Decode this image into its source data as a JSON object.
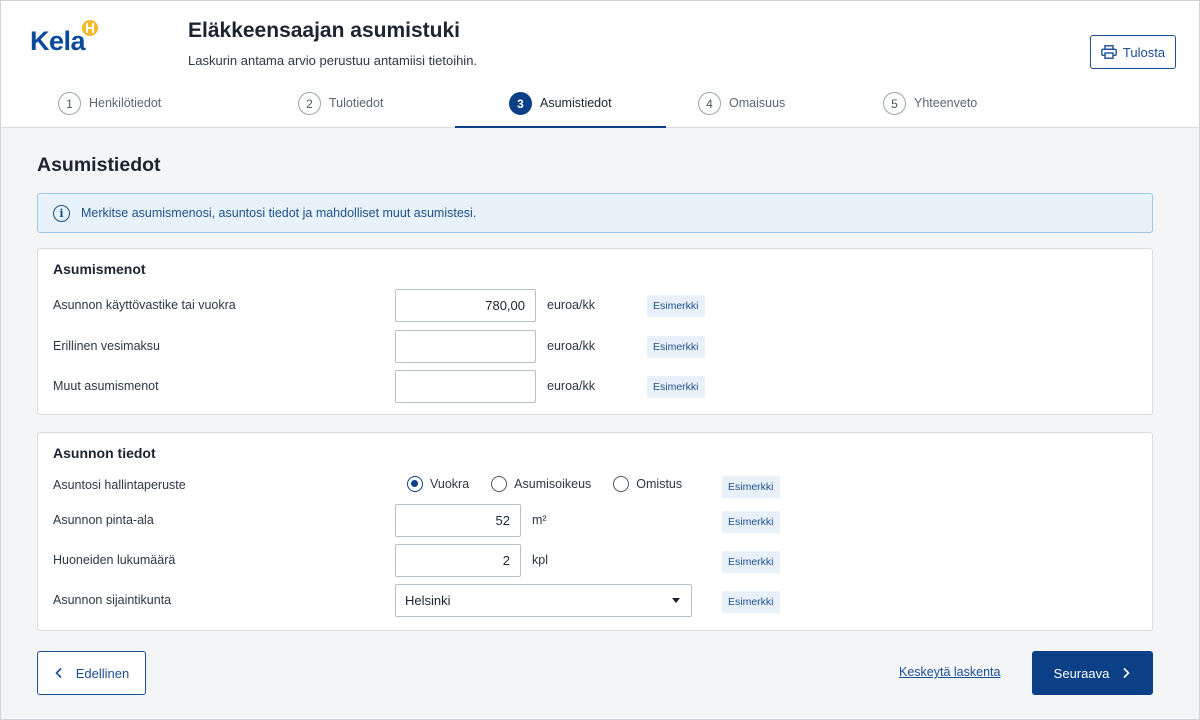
{
  "header": {
    "logo_text": "Kela",
    "title": "Eläkkeensaajan asumistuki",
    "subtitle": "Laskurin antama arvio perustuu antamiisi tietoihin.",
    "print_label": "Tulosta"
  },
  "stepper": {
    "steps": [
      {
        "number": "1",
        "label": "Henkilötiedot"
      },
      {
        "number": "2",
        "label": "Tulotiedot"
      },
      {
        "number": "3",
        "label": "Asumistiedot"
      },
      {
        "number": "4",
        "label": "Omaisuus"
      },
      {
        "number": "5",
        "label": "Yhteenveto"
      }
    ],
    "active_index": 2
  },
  "main": {
    "page_title": "Asumistiedot",
    "info_text": "Merkitse asumismenosi, asuntosi tiedot ja mahdolliset muut asumistesi."
  },
  "housing_costs": {
    "title": "Asumismenot",
    "rows": [
      {
        "label": "Asunnon käyttövastike tai vuokra",
        "value": "780,00",
        "unit": "euroa/kk",
        "example": "Esimerkki"
      },
      {
        "label": "Erillinen vesimaksu",
        "value": "",
        "unit": "euroa/kk",
        "example": "Esimerkki"
      },
      {
        "label": "Muut asumismenot",
        "value": "",
        "unit": "euroa/kk",
        "example": "Esimerkki"
      }
    ]
  },
  "housing_info": {
    "title": "Asunnon tiedot",
    "tenure_label": "Asuntosi hallintaperuste",
    "tenure_options": [
      "Vuokra",
      "Asumisoikeus",
      "Omistus"
    ],
    "tenure_selected": "Vuokra",
    "area_label": "Asunnon pinta-ala",
    "area_value": "52",
    "area_unit": "m²",
    "rooms_label": "Huoneiden lukumäärä",
    "rooms_value": "2",
    "rooms_unit": "kpl",
    "municipality_label": "Asunnon sijaintikunta",
    "municipality_value": "Helsinki",
    "example": "Esimerkki"
  },
  "footer": {
    "prev_label": "Edellinen",
    "cancel_label": "Keskeytä laskenta",
    "next_label": "Seuraava"
  },
  "colors": {
    "primary": "#0b3f86",
    "info_bg": "#e7f2fb",
    "logo_accent": "#f6b728"
  }
}
